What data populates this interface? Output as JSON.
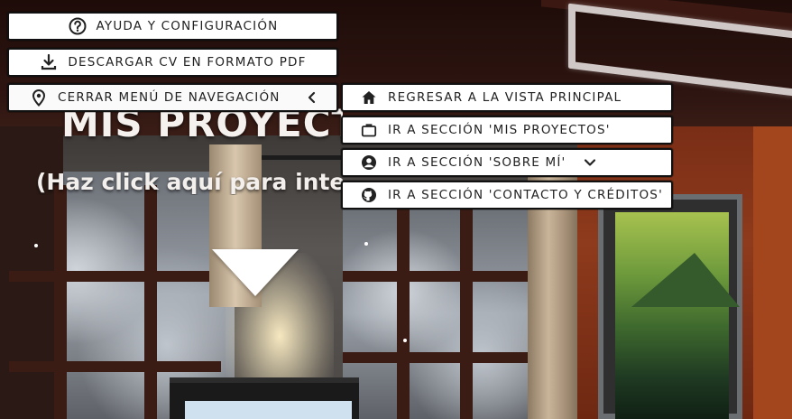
{
  "scene": {
    "title": "MIS PROYECTOS",
    "hint": "(Haz click aquí para interactuar)",
    "colors": {
      "wall": "#7a2e16",
      "ceiling": "#1e0c09",
      "curtain": "#c9b59a"
    }
  },
  "menu": {
    "help_label": "AYUDA Y CONFIGURACIÓN",
    "cv_label": "DESCARGAR CV EN FORMATO PDF",
    "close_nav_label": "CERRAR MENÚ DE NAVEGACIÓN",
    "icons": {
      "help": "question-circle-icon",
      "cv": "download-icon",
      "close_nav": "location-pin-icon",
      "collapse": "chevron-left-icon"
    }
  },
  "submenu": {
    "items": [
      {
        "label": "REGRESAR A LA VISTA PRINCIPAL",
        "icon": "home-icon"
      },
      {
        "label": "IR A SECCIÓN 'MIS PROYECTOS'",
        "icon": "briefcase-icon"
      },
      {
        "label": "IR A SECCIÓN 'SOBRE MÍ'",
        "icon": "user-circle-icon",
        "expand_icon": "chevron-down-icon"
      },
      {
        "label": "IR A SECCIÓN 'CONTACTO Y CRÉDITOS'",
        "icon": "github-icon"
      }
    ]
  }
}
